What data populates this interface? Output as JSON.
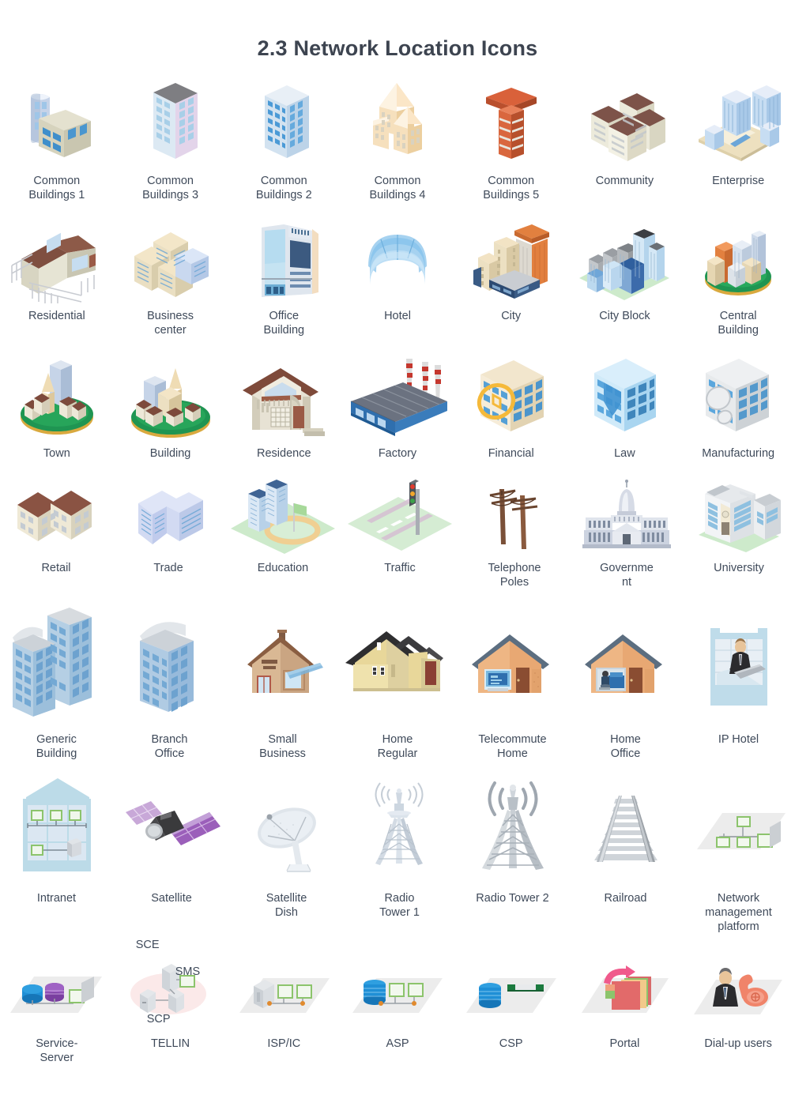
{
  "page": {
    "title": "2.3 Network Location Icons",
    "text_color": "#3f4a5a",
    "title_color": "#3d4450",
    "background": "#ffffff"
  },
  "rows": [
    {
      "id": "r1",
      "items": [
        {
          "label": "Common\nBuildings 1",
          "icon": "common-buildings-1-icon"
        },
        {
          "label": "Common\nBuildings 3",
          "icon": "common-buildings-3-icon"
        },
        {
          "label": "Common\nBuildings 2",
          "icon": "common-buildings-2-icon"
        },
        {
          "label": "Common\nBuildings 4",
          "icon": "common-buildings-4-icon"
        },
        {
          "label": "Common\nBuildings 5",
          "icon": "common-buildings-5-icon"
        },
        {
          "label": "Community",
          "icon": "community-icon"
        },
        {
          "label": "Enterprise",
          "icon": "enterprise-icon"
        }
      ]
    },
    {
      "id": "r2",
      "items": [
        {
          "label": "Residential",
          "icon": "residential-icon"
        },
        {
          "label": "Business\ncenter",
          "icon": "business-center-icon"
        },
        {
          "label": "Office\nBuilding",
          "icon": "office-building-icon"
        },
        {
          "label": "Hotel",
          "icon": "hotel-icon"
        },
        {
          "label": "City",
          "icon": "city-icon"
        },
        {
          "label": "City Block",
          "icon": "city-block-icon"
        },
        {
          "label": "Central\nBuilding",
          "icon": "central-building-icon"
        }
      ]
    },
    {
      "id": "r3",
      "items": [
        {
          "label": "Town",
          "icon": "town-icon"
        },
        {
          "label": "Building",
          "icon": "building-icon"
        },
        {
          "label": "Residence",
          "icon": "residence-icon"
        },
        {
          "label": "Factory",
          "icon": "factory-icon"
        },
        {
          "label": "Financial",
          "icon": "financial-icon"
        },
        {
          "label": "Law",
          "icon": "law-icon"
        },
        {
          "label": "Manufacturing",
          "icon": "manufacturing-icon"
        }
      ]
    },
    {
      "id": "r4",
      "items": [
        {
          "label": "Retail",
          "icon": "retail-icon"
        },
        {
          "label": "Trade",
          "icon": "trade-icon"
        },
        {
          "label": "Education",
          "icon": "education-icon"
        },
        {
          "label": "Traffic",
          "icon": "traffic-icon"
        },
        {
          "label": "Telephone\nPoles",
          "icon": "telephone-poles-icon"
        },
        {
          "label": "Governme\nnt",
          "icon": "government-icon"
        },
        {
          "label": "University",
          "icon": "university-icon"
        }
      ]
    },
    {
      "id": "r5",
      "items": [
        {
          "label": "Generic\nBuilding",
          "icon": "generic-building-icon"
        },
        {
          "label": "Branch\nOffice",
          "icon": "branch-office-icon"
        },
        {
          "label": "Small\nBusiness",
          "icon": "small-business-icon"
        },
        {
          "label": "Home\nRegular",
          "icon": "home-regular-icon"
        },
        {
          "label": "Telecommute\nHome",
          "icon": "telecommute-home-icon"
        },
        {
          "label": "Home\nOffice",
          "icon": "home-office-icon"
        },
        {
          "label": "IP Hotel",
          "icon": "ip-hotel-icon"
        }
      ]
    },
    {
      "id": "r6",
      "items": [
        {
          "label": "Intranet",
          "icon": "intranet-icon"
        },
        {
          "label": "Satellite",
          "icon": "satellite-icon"
        },
        {
          "label": "Satellite\nDish",
          "icon": "satellite-dish-icon"
        },
        {
          "label": "Radio\nTower 1",
          "icon": "radio-tower-1-icon"
        },
        {
          "label": "Radio Tower 2",
          "icon": "radio-tower-2-icon"
        },
        {
          "label": "Railroad",
          "icon": "railroad-icon"
        },
        {
          "label": "Network\nmanagement\nplatform",
          "icon": "network-management-platform-icon"
        }
      ]
    },
    {
      "id": "r7",
      "items": [
        {
          "label": "Service-\nServer",
          "icon": "service-server-icon"
        },
        {
          "label": "TELLIN",
          "icon": "tellin-icon",
          "annotations": {
            "top": "SCE",
            "middle": "SMS",
            "bottom": "SCP"
          }
        },
        {
          "label": "ISP/IC",
          "icon": "isp-ic-icon"
        },
        {
          "label": "ASP",
          "icon": "asp-icon"
        },
        {
          "label": "CSP",
          "icon": "csp-icon"
        },
        {
          "label": "Portal",
          "icon": "portal-icon"
        },
        {
          "label": "Dial-up users",
          "icon": "dial-up-users-icon"
        }
      ]
    }
  ],
  "palette": {
    "blue_window": "#4f9bd9",
    "light_blue": "#bcd8ef",
    "pale_blue": "#dbe9f6",
    "cream": "#e9e2cf",
    "tan": "#f0dfc0",
    "orange": "#e2803f",
    "brown_roof": "#7d4a3c",
    "green": "#1e9d55",
    "grass": "#c8e6c9",
    "grey": "#b9bfc6",
    "purple": "#9b6fb5",
    "dark_roof": "#3b3b3b",
    "plane": "#ececec",
    "node_green": "#a8dc8c",
    "db_blue": "#1f8fd6",
    "pink": "#f05a8c"
  }
}
